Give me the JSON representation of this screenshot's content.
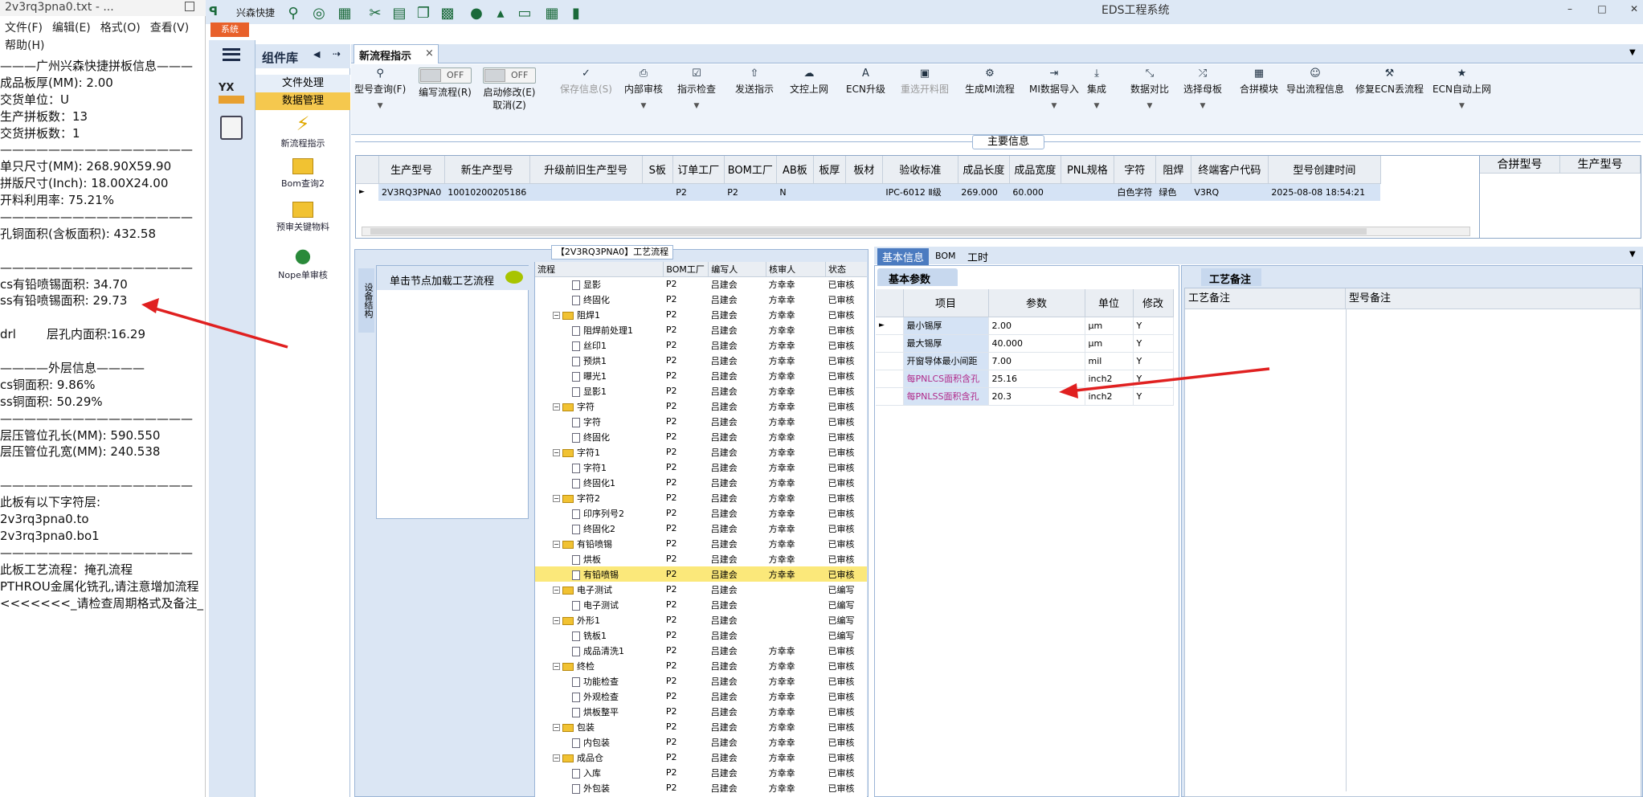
{
  "notepad": {
    "title": "2v3rq3pna0.txt - ...",
    "menu": [
      "文件(F)",
      "编辑(E)",
      "格式(O)",
      "查看(V)",
      "帮助(H)"
    ],
    "lines": [
      "———广州兴森快捷拼板信息———",
      "成品板厚(MM): 2.00",
      "交货单位：U",
      "生产拼板数：13",
      "交货拼板数：1",
      "————————————————",
      "单只尺寸(MM): 268.90X59.90",
      "拼版尺寸(Inch): 18.00X24.00",
      "开料利用率: 75.21%",
      "————————————————",
      "孔铜面积(含板面积): 432.58",
      "",
      "————————————————",
      "cs有铅喷锡面积: 34.70",
      "ss有铅喷锡面积: 29.73",
      "",
      "drl        层孔内面积:16.29",
      "",
      "————外层信息————",
      "cs铜面积: 9.86%",
      "ss铜面积: 50.29%",
      "————————————————",
      "层压管位孔长(MM): 590.550",
      "层压管位孔宽(MM): 240.538",
      "",
      "————————————————",
      "此板有以下字符层:",
      "2v3rq3pna0.to",
      "2v3rq3pna0.bo1",
      "————————————————",
      "此板工艺流程：掩孔流程",
      "PTHROU金属化铣孔,请注意增加流程",
      "<<<<<<<_请检查周期格式及备注_"
    ]
  },
  "app": {
    "brand": "兴森快捷",
    "title": "EDS工程系统",
    "system_btn": "系统"
  },
  "complib": {
    "title": "组件库",
    "items": [
      "文件处理",
      "数据管理"
    ],
    "tools": [
      "新流程指示",
      "Bom查询2",
      "预审关键物料",
      "Nope单审核"
    ]
  },
  "tab": {
    "label": "新流程指示"
  },
  "ribbon": {
    "buttons": [
      {
        "label": "型号查询(F)",
        "dd": true
      },
      {
        "label": "编写流程(R)",
        "toggle": "OFF"
      },
      {
        "label": "启动修改(E)\n取消(Z)",
        "toggle": "OFF"
      },
      {
        "label": "保存信息(S)",
        "disabled": true
      },
      {
        "label": "内部审核",
        "dd": true
      },
      {
        "label": "指示检查",
        "dd": true
      },
      {
        "label": "发送指示"
      },
      {
        "label": "文控上网"
      },
      {
        "label": "ECN升级"
      },
      {
        "label": "重选开料图",
        "disabled": true
      },
      {
        "label": "生成MI流程"
      },
      {
        "label": "MI数据导入",
        "dd": true
      },
      {
        "label": "集成",
        "dd": true
      },
      {
        "label": "数据对比",
        "dd": true
      },
      {
        "label": "选择母板",
        "dd": true
      },
      {
        "label": "合拼模块"
      },
      {
        "label": "导出流程信息"
      },
      {
        "label": "修复ECN丢流程"
      },
      {
        "label": "ECN自动上网",
        "dd": true
      }
    ]
  },
  "main_info": {
    "label": "主要信息",
    "columns": [
      "生产型号",
      "新生产型号",
      "升级前旧生产型号",
      "S板",
      "订单工厂",
      "BOM工厂",
      "AB板",
      "板厚",
      "板材",
      "验收标准",
      "成品长度",
      "成品宽度",
      "PNL规格",
      "字符",
      "阻焊",
      "终端客户代码",
      "型号创建时间"
    ],
    "row": [
      "2V3RQ3PNA0",
      "10010200205186",
      "",
      "",
      "P2",
      "P2",
      "N",
      "",
      "",
      "IPC-6012 Ⅱ级",
      "269.000",
      "60.000",
      "",
      "白色字符",
      "绿色",
      "V3RQ",
      "2025-08-08 18:54:21"
    ],
    "merge_columns": [
      "合拼型号",
      "生产型号"
    ]
  },
  "flow": {
    "title": "【2V3RQ3PNA0】工艺流程",
    "side_tab": "设备结构",
    "load_hint": "单击节点加载工艺流程",
    "columns": [
      "流程",
      "BOM工厂",
      "编写人",
      "核审人",
      "状态"
    ],
    "rows": [
      {
        "name": "显影",
        "lvl": 2,
        "bom": "P2",
        "w": "吕建会",
        "r": "方幸幸",
        "s": "已审核"
      },
      {
        "name": "终固化",
        "lvl": 2,
        "bom": "P2",
        "w": "吕建会",
        "r": "方幸幸",
        "s": "已审核"
      },
      {
        "name": "阻焊1",
        "lvl": 1,
        "bom": "P2",
        "w": "吕建会",
        "r": "方幸幸",
        "s": "已审核"
      },
      {
        "name": "阻焊前处理1",
        "lvl": 2,
        "bom": "P2",
        "w": "吕建会",
        "r": "方幸幸",
        "s": "已审核"
      },
      {
        "name": "丝印1",
        "lvl": 2,
        "bom": "P2",
        "w": "吕建会",
        "r": "方幸幸",
        "s": "已审核"
      },
      {
        "name": "预烘1",
        "lvl": 2,
        "bom": "P2",
        "w": "吕建会",
        "r": "方幸幸",
        "s": "已审核"
      },
      {
        "name": "曝光1",
        "lvl": 2,
        "bom": "P2",
        "w": "吕建会",
        "r": "方幸幸",
        "s": "已审核"
      },
      {
        "name": "显影1",
        "lvl": 2,
        "bom": "P2",
        "w": "吕建会",
        "r": "方幸幸",
        "s": "已审核"
      },
      {
        "name": "字符",
        "lvl": 1,
        "bom": "P2",
        "w": "吕建会",
        "r": "方幸幸",
        "s": "已审核"
      },
      {
        "name": "字符",
        "lvl": 2,
        "bom": "P2",
        "w": "吕建会",
        "r": "方幸幸",
        "s": "已审核"
      },
      {
        "name": "终固化",
        "lvl": 2,
        "bom": "P2",
        "w": "吕建会",
        "r": "方幸幸",
        "s": "已审核"
      },
      {
        "name": "字符1",
        "lvl": 1,
        "bom": "P2",
        "w": "吕建会",
        "r": "方幸幸",
        "s": "已审核"
      },
      {
        "name": "字符1",
        "lvl": 2,
        "bom": "P2",
        "w": "吕建会",
        "r": "方幸幸",
        "s": "已审核"
      },
      {
        "name": "终固化1",
        "lvl": 2,
        "bom": "P2",
        "w": "吕建会",
        "r": "方幸幸",
        "s": "已审核"
      },
      {
        "name": "字符2",
        "lvl": 1,
        "bom": "P2",
        "w": "吕建会",
        "r": "方幸幸",
        "s": "已审核"
      },
      {
        "name": "印序列号2",
        "lvl": 2,
        "bom": "P2",
        "w": "吕建会",
        "r": "方幸幸",
        "s": "已审核"
      },
      {
        "name": "终固化2",
        "lvl": 2,
        "bom": "P2",
        "w": "吕建会",
        "r": "方幸幸",
        "s": "已审核"
      },
      {
        "name": "有铅喷锡",
        "lvl": 1,
        "bom": "P2",
        "w": "吕建会",
        "r": "方幸幸",
        "s": "已审核"
      },
      {
        "name": "烘板",
        "lvl": 2,
        "bom": "P2",
        "w": "吕建会",
        "r": "方幸幸",
        "s": "已审核"
      },
      {
        "name": "有铅喷锡",
        "lvl": 2,
        "bom": "P2",
        "w": "吕建会",
        "r": "方幸幸",
        "s": "已审核",
        "sel": true
      },
      {
        "name": "电子测试",
        "lvl": 1,
        "bom": "P2",
        "w": "吕建会",
        "r": "",
        "s": "已编写"
      },
      {
        "name": "电子测试",
        "lvl": 2,
        "bom": "P2",
        "w": "吕建会",
        "r": "",
        "s": "已编写"
      },
      {
        "name": "外形1",
        "lvl": 1,
        "bom": "P2",
        "w": "吕建会",
        "r": "",
        "s": "已编写"
      },
      {
        "name": "铣板1",
        "lvl": 2,
        "bom": "P2",
        "w": "吕建会",
        "r": "",
        "s": "已编写"
      },
      {
        "name": "成品清洗1",
        "lvl": 2,
        "bom": "P2",
        "w": "吕建会",
        "r": "方幸幸",
        "s": "已审核"
      },
      {
        "name": "终检",
        "lvl": 1,
        "bom": "P2",
        "w": "吕建会",
        "r": "方幸幸",
        "s": "已审核"
      },
      {
        "name": "功能检查",
        "lvl": 2,
        "bom": "P2",
        "w": "吕建会",
        "r": "方幸幸",
        "s": "已审核"
      },
      {
        "name": "外观检查",
        "lvl": 2,
        "bom": "P2",
        "w": "吕建会",
        "r": "方幸幸",
        "s": "已审核"
      },
      {
        "name": "烘板整平",
        "lvl": 2,
        "bom": "P2",
        "w": "吕建会",
        "r": "方幸幸",
        "s": "已审核"
      },
      {
        "name": "包装",
        "lvl": 1,
        "bom": "P2",
        "w": "吕建会",
        "r": "方幸幸",
        "s": "已审核"
      },
      {
        "name": "内包装",
        "lvl": 2,
        "bom": "P2",
        "w": "吕建会",
        "r": "方幸幸",
        "s": "已审核"
      },
      {
        "name": "成品仓",
        "lvl": 1,
        "bom": "P2",
        "w": "吕建会",
        "r": "方幸幸",
        "s": "已审核"
      },
      {
        "name": "入库",
        "lvl": 2,
        "bom": "P2",
        "w": "吕建会",
        "r": "方幸幸",
        "s": "已审核"
      },
      {
        "name": "外包装",
        "lvl": 2,
        "bom": "P2",
        "w": "吕建会",
        "r": "方幸幸",
        "s": "已审核"
      }
    ]
  },
  "basic": {
    "tabs": [
      "基本信息",
      "BOM",
      "工时"
    ],
    "panel_title": "基本参数",
    "columns": [
      "项目",
      "参数",
      "单位",
      "修改"
    ],
    "rows": [
      {
        "item": "最小锡厚",
        "val": "2.00",
        "unit": "μm",
        "mod": "Y"
      },
      {
        "item": "最大锡厚",
        "val": "40.000",
        "unit": "μm",
        "mod": "Y"
      },
      {
        "item": "开窗导体最小间距",
        "val": "7.00",
        "unit": "mil",
        "mod": "Y"
      },
      {
        "item": "每PNLCS面积含孔",
        "val": "25.16",
        "unit": "inch2",
        "mod": "Y",
        "hl": true
      },
      {
        "item": "每PNLSS面积含孔",
        "val": "20.3",
        "unit": "inch2",
        "mod": "Y",
        "hl": true
      }
    ]
  },
  "notes": {
    "panel_title": "工艺备注",
    "columns": [
      "工艺备注",
      "型号备注"
    ]
  },
  "colors": {
    "accent": "#4b7bc0",
    "arrow": "#e02020",
    "selected_row": "#fbe87a",
    "system_btn": "#e8602a"
  }
}
